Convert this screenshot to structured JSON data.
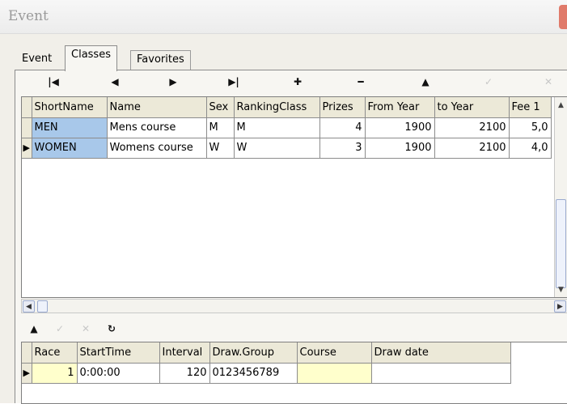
{
  "window": {
    "title": "Event"
  },
  "tabs": [
    {
      "label": "Event",
      "active": false
    },
    {
      "label": "Classes",
      "active": true
    },
    {
      "label": "Favorites",
      "active": false
    }
  ],
  "navigator": {
    "buttons": [
      {
        "name": "first-record-button",
        "glyph": "|◀",
        "enabled": true
      },
      {
        "name": "prior-record-button",
        "glyph": "◀",
        "enabled": true
      },
      {
        "name": "next-record-button",
        "glyph": "▶",
        "enabled": true
      },
      {
        "name": "last-record-button",
        "glyph": "▶|",
        "enabled": true
      },
      {
        "name": "insert-record-button",
        "glyph": "✚",
        "enabled": true
      },
      {
        "name": "delete-record-button",
        "glyph": "━",
        "enabled": true
      },
      {
        "name": "edit-record-button",
        "glyph": "▲",
        "enabled": true
      },
      {
        "name": "post-record-button",
        "glyph": "✓",
        "enabled": false
      },
      {
        "name": "cancel-record-button",
        "glyph": "✕",
        "enabled": false
      }
    ]
  },
  "classes_grid": {
    "columns": [
      "ShortName",
      "Name",
      "Sex",
      "RankingClass",
      "Prizes",
      "From Year",
      "to Year",
      "Fee 1"
    ],
    "rows": [
      {
        "indicator": "",
        "cells": [
          "MEN",
          "Mens course",
          "M",
          "M",
          "4",
          "1900",
          "2100",
          "5,0"
        ]
      },
      {
        "indicator": "▶",
        "cells": [
          "WOMEN",
          "Womens course",
          "W",
          "W",
          "3",
          "1900",
          "2100",
          "4,0"
        ]
      }
    ]
  },
  "sub_navigator": {
    "buttons": [
      {
        "name": "edit-race-button",
        "glyph": "▲",
        "enabled": true
      },
      {
        "name": "post-race-button",
        "glyph": "✓",
        "enabled": false
      },
      {
        "name": "cancel-race-button",
        "glyph": "✕",
        "enabled": false
      },
      {
        "name": "refresh-race-button",
        "glyph": "↻",
        "enabled": true
      }
    ]
  },
  "races_grid": {
    "columns": [
      "Race",
      "StartTime",
      "Interval",
      "Draw.Group",
      "Course",
      "Draw date"
    ],
    "rows": [
      {
        "indicator": "▶",
        "cells": [
          "1",
          "0:00:00",
          "120",
          "0123456789",
          "",
          ""
        ]
      }
    ]
  }
}
